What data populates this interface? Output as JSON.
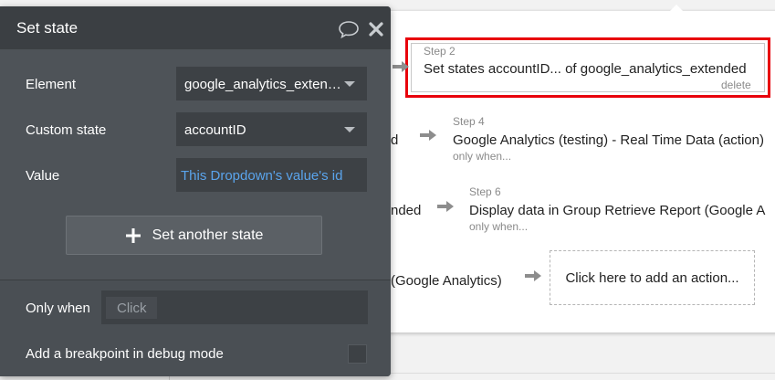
{
  "editor": {
    "title": "Set state",
    "element_label": "Element",
    "element_value": "google_analytics_exten…",
    "custom_state_label": "Custom state",
    "custom_state_value": "accountID",
    "value_label": "Value",
    "value_text": "This Dropdown's value's id",
    "set_another_label": "Set another state",
    "only_when_label": "Only when",
    "only_when_placeholder": "Click",
    "breakpoint_label": "Add a breakpoint in debug mode",
    "icons": {
      "comment": "comment-icon",
      "close": "close-icon",
      "plus": "plus-icon"
    }
  },
  "workflow": {
    "steps": [
      {
        "number": "Step 2",
        "title": "Set states accountID... of google_analytics_extended",
        "action": "delete",
        "selected": true
      },
      {
        "number": "Step 4",
        "title": "Google Analytics (testing) - Real Time Data (action)",
        "sub": "only when..."
      },
      {
        "number": "Step 6",
        "title": "Display data in Group Retrieve Report (Google A",
        "sub": "only when..."
      }
    ],
    "partial_texts": [
      "d",
      "nded",
      "(Google Analytics)"
    ],
    "add_action_label": "Click here to add an action..."
  },
  "colors": {
    "selection_border": "#e8000b",
    "link_blue": "#5aa4ec",
    "editor_bg": "#4e5358",
    "editor_header": "#3b3f43"
  }
}
